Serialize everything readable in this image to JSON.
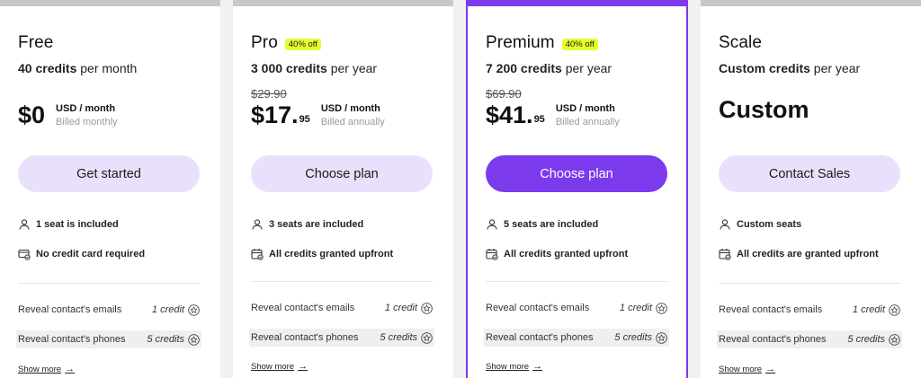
{
  "plans": [
    {
      "name": "Free",
      "badge": "",
      "credits_bold": "40 credits",
      "credits_period": " per month",
      "old_price": "",
      "price_main": "$0",
      "price_cents": "",
      "price_unit": "USD / month",
      "billing": "Billed monthly",
      "cta": "Get started",
      "features": [
        "1 seat is included",
        "No credit card required"
      ],
      "actions": [
        {
          "label": "Reveal contact's emails",
          "cost": "1 credit"
        },
        {
          "label": "Reveal contact's phones",
          "cost": "5 credits"
        }
      ],
      "show_more": "Show more"
    },
    {
      "name": "Pro",
      "badge": "40% off",
      "credits_bold": "3 000 credits",
      "credits_period": " per year",
      "old_price": "$29.90",
      "price_main": "$17.",
      "price_cents": "95",
      "price_unit": "USD / month",
      "billing": "Billed annually",
      "cta": "Choose plan",
      "features": [
        "3 seats are included",
        "All credits granted upfront"
      ],
      "actions": [
        {
          "label": "Reveal contact's emails",
          "cost": "1 credit"
        },
        {
          "label": "Reveal contact's phones",
          "cost": "5 credits"
        }
      ],
      "show_more": "Show more"
    },
    {
      "name": "Premium",
      "badge": "40% off",
      "credits_bold": "7 200 credits",
      "credits_period": " per year",
      "old_price": "$69.90",
      "price_main": "$41.",
      "price_cents": "95",
      "price_unit": "USD / month",
      "billing": "Billed annually",
      "cta": "Choose plan",
      "features": [
        "5 seats are included",
        "All credits granted upfront"
      ],
      "actions": [
        {
          "label": "Reveal contact's emails",
          "cost": "1 credit"
        },
        {
          "label": "Reveal contact's phones",
          "cost": "5 credits"
        }
      ],
      "show_more": "Show more"
    },
    {
      "name": "Scale",
      "badge": "",
      "credits_bold": "Custom credits",
      "credits_period": " per year",
      "old_price": "",
      "custom_price": "Custom",
      "cta": "Contact Sales",
      "features": [
        "Custom seats",
        "All credits are granted upfront"
      ],
      "actions": [
        {
          "label": "Reveal contact's emails",
          "cost": "1 credit"
        },
        {
          "label": "Reveal contact's phones",
          "cost": "5 credits"
        }
      ],
      "show_more": "Show more"
    }
  ],
  "icons": {
    "seat": "user-icon",
    "card": "credit-card-check-icon",
    "calendar": "calendar-check-icon",
    "credit": "star-badge-icon",
    "arrow": "arrow-right-icon"
  },
  "colors": {
    "accent": "#7c3aed",
    "accent_light": "#e9e1fb",
    "badge": "#e6ff2b",
    "background": "#f1f1f1"
  }
}
